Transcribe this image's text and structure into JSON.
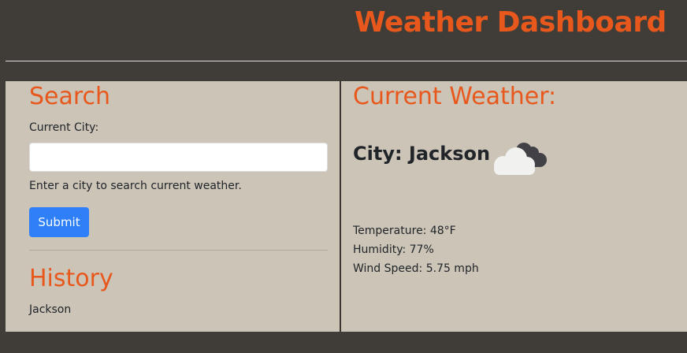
{
  "header": {
    "title": "Weather Dashboard"
  },
  "search": {
    "heading": "Search",
    "label": "Current City:",
    "input_value": "",
    "input_placeholder": "",
    "help": "Enter a city to search current weather.",
    "submit_label": "Submit"
  },
  "history": {
    "heading": "History",
    "items": [
      "Jackson"
    ]
  },
  "current": {
    "heading": "Current Weather:",
    "city": "City: Jackson",
    "icon": "cloudy-icon",
    "temperature": "Temperature: 48°F",
    "humidity": "Humidity: 77%",
    "wind": "Wind Speed: 5.75 mph"
  },
  "colors": {
    "accent": "#e8581c",
    "background": "#403c37",
    "panel": "#cbc4b7",
    "button": "#2f80f8"
  }
}
